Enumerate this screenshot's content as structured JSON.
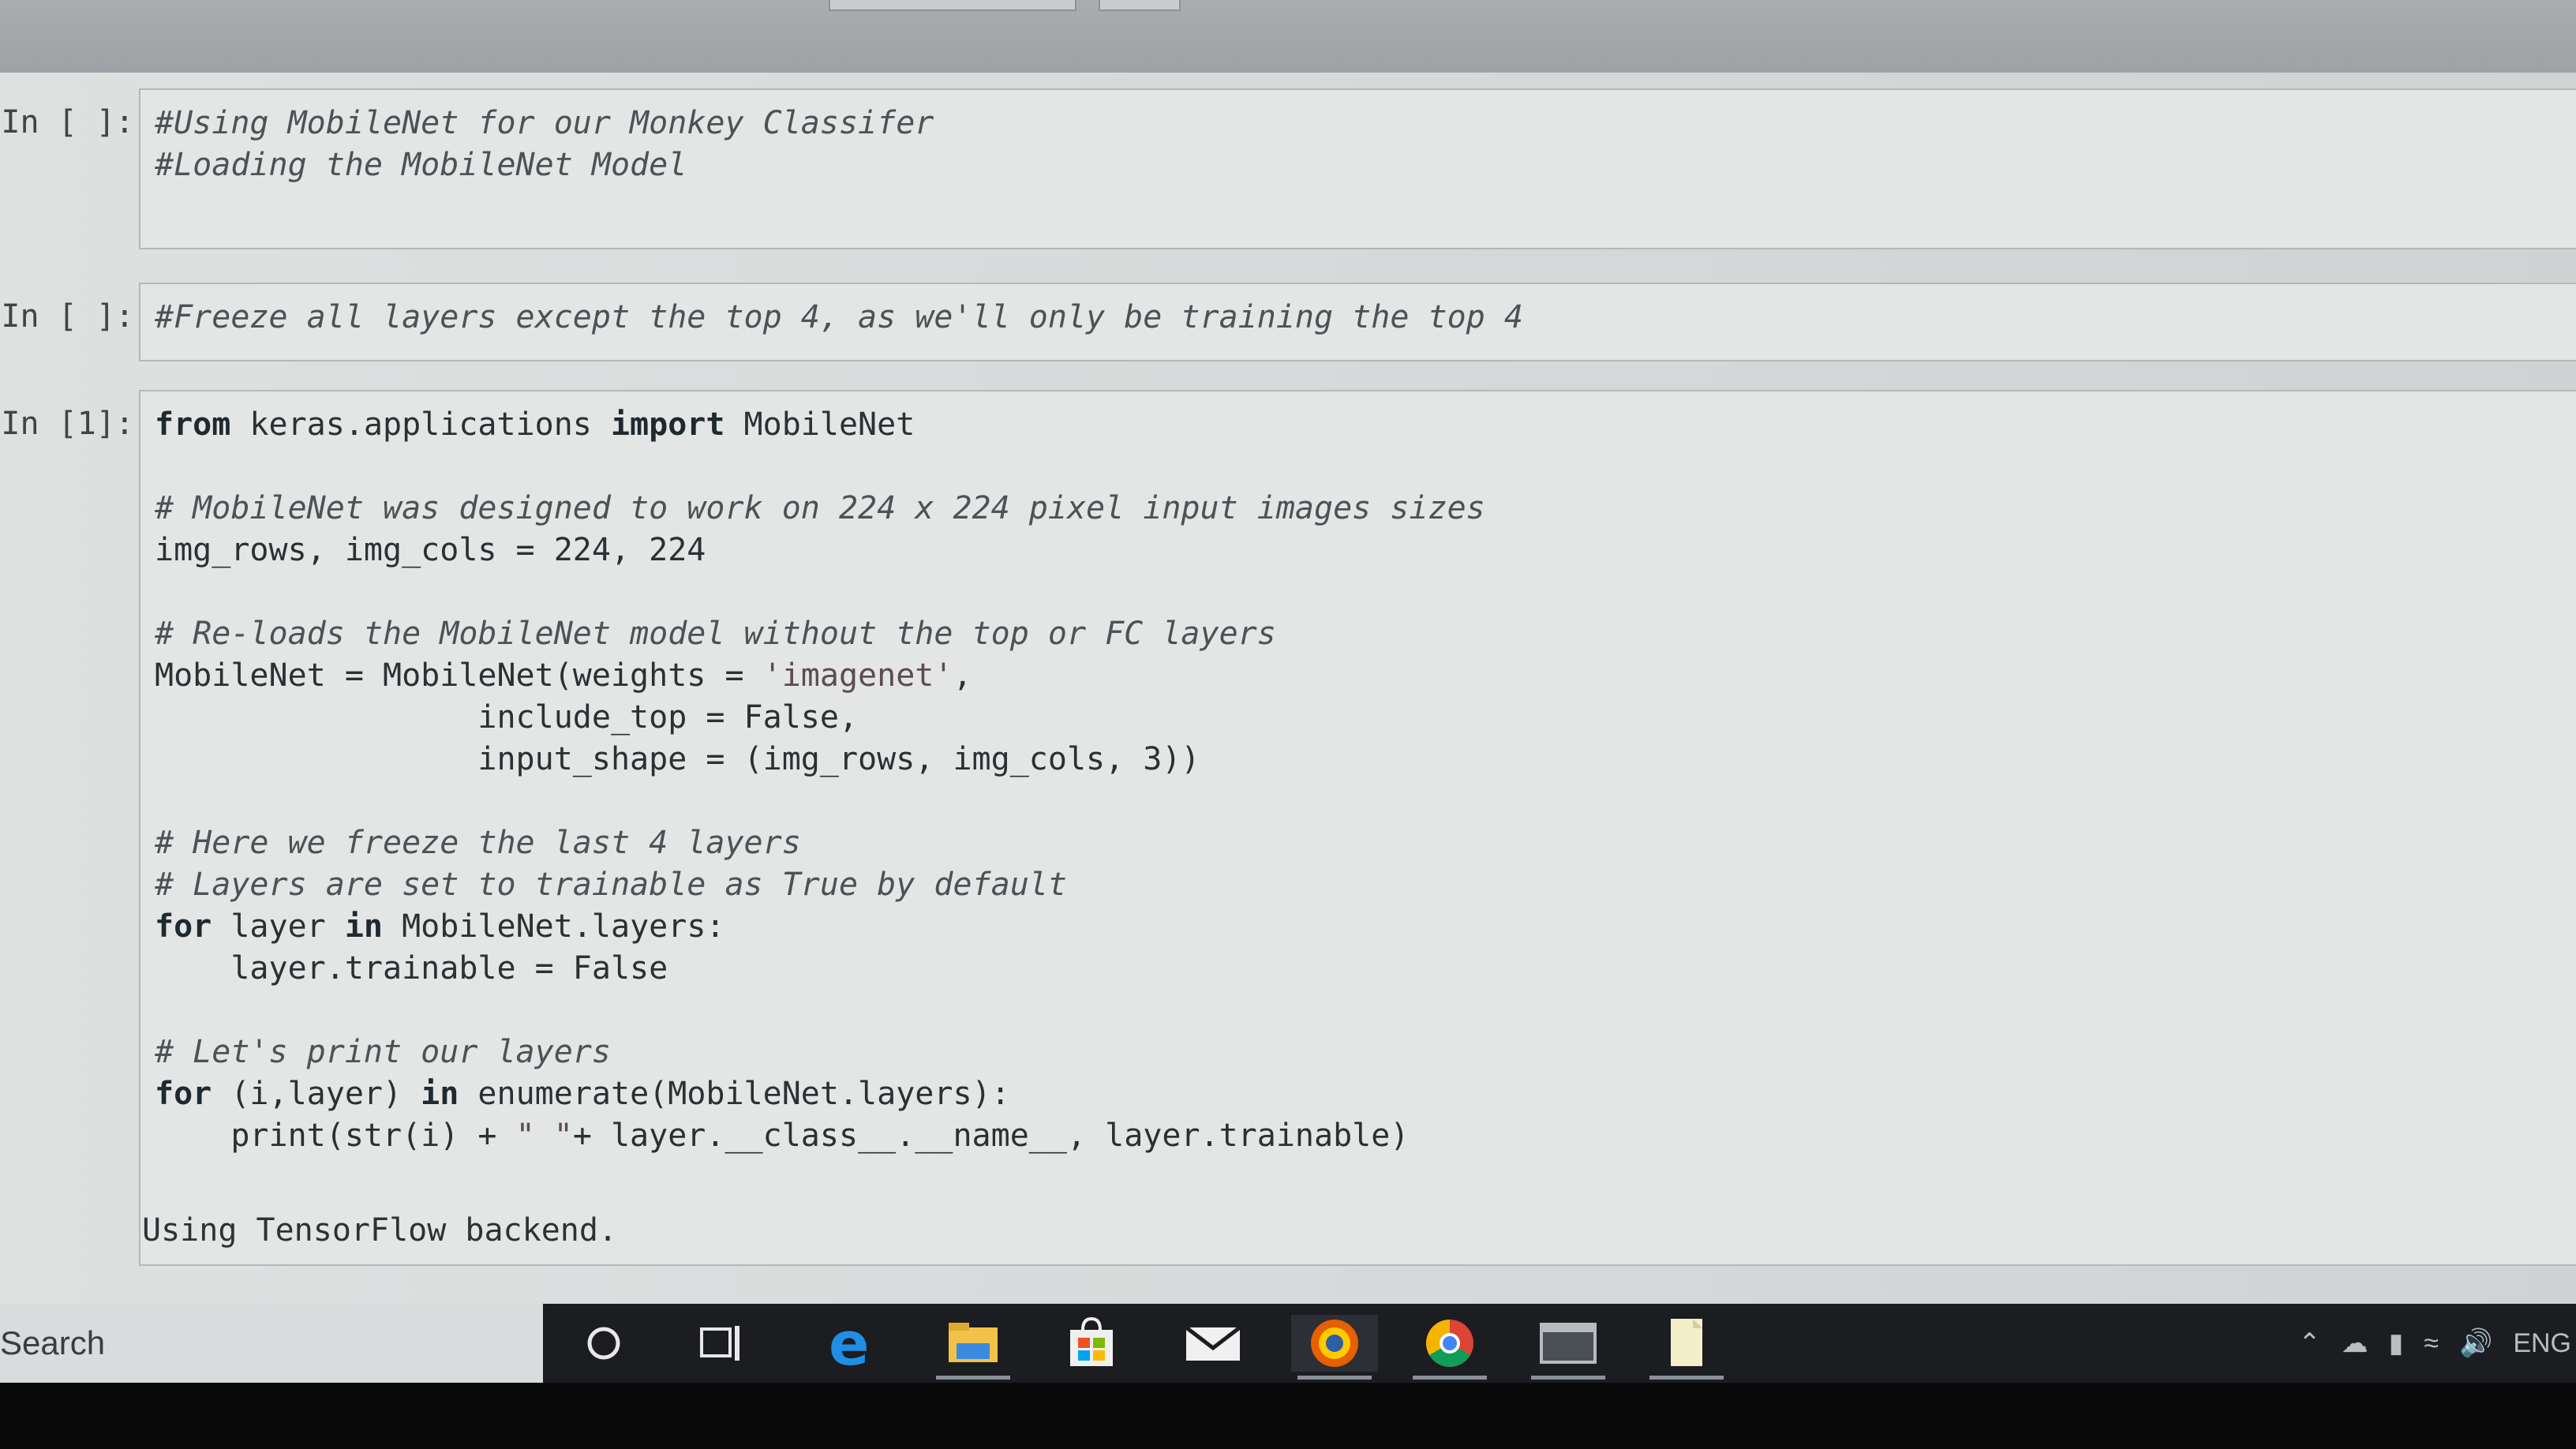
{
  "cells": [
    {
      "prompt": "In [ ]:",
      "lines": [
        [
          {
            "t": "#Using MobileNet for our Monkey Classifer",
            "c": "cm"
          }
        ],
        [
          {
            "t": "#Loading the MobileNet Model",
            "c": "cm"
          }
        ]
      ]
    },
    {
      "prompt": "In [ ]:",
      "lines": [
        [
          {
            "t": "#Freeze all layers except the top 4, as we'll only be training the top 4",
            "c": "cm"
          }
        ]
      ]
    },
    {
      "prompt": "In [1]:",
      "lines": [
        [
          {
            "t": "from",
            "c": "kw"
          },
          {
            "t": " keras.applications "
          },
          {
            "t": "import",
            "c": "kw"
          },
          {
            "t": " MobileNet"
          }
        ],
        [
          {
            "t": ""
          }
        ],
        [
          {
            "t": "# MobileNet was designed to work on 224 x 224 pixel input images sizes",
            "c": "cm"
          }
        ],
        [
          {
            "t": "img_rows, img_cols = 224, 224"
          }
        ],
        [
          {
            "t": ""
          }
        ],
        [
          {
            "t": "# Re-loads the MobileNet model without the top or FC layers",
            "c": "cm"
          }
        ],
        [
          {
            "t": "MobileNet = MobileNet(weights = "
          },
          {
            "t": "'imagenet'",
            "c": "str"
          },
          {
            "t": ","
          }
        ],
        [
          {
            "t": "                 include_top = False,"
          }
        ],
        [
          {
            "t": "                 input_shape = (img_rows, img_cols, 3))"
          }
        ],
        [
          {
            "t": ""
          }
        ],
        [
          {
            "t": "# Here we freeze the last 4 layers",
            "c": "cm"
          }
        ],
        [
          {
            "t": "# Layers are set to trainable as True by default",
            "c": "cm"
          }
        ],
        [
          {
            "t": "for",
            "c": "kw"
          },
          {
            "t": " layer "
          },
          {
            "t": "in",
            "c": "kw"
          },
          {
            "t": " MobileNet.layers:"
          }
        ],
        [
          {
            "t": "    layer.trainable = False"
          }
        ],
        [
          {
            "t": ""
          }
        ],
        [
          {
            "t": "# Let's print our layers",
            "c": "cm"
          }
        ],
        [
          {
            "t": "for",
            "c": "kw"
          },
          {
            "t": " (i,layer) "
          },
          {
            "t": "in",
            "c": "kw"
          },
          {
            "t": " enumerate(MobileNet.layers):"
          }
        ],
        [
          {
            "t": "    print(str(i) + "
          },
          {
            "t": "\" \"",
            "c": "str"
          },
          {
            "t": "+ layer.__class__.__name__, layer.trainable)"
          }
        ]
      ],
      "output": "Using TensorFlow backend."
    }
  ],
  "taskbar": {
    "search_label": "Search",
    "apps": [
      {
        "name": "cortana-icon"
      },
      {
        "name": "task-view-icon"
      },
      {
        "name": "edge-icon"
      },
      {
        "name": "file-explorer-icon"
      },
      {
        "name": "store-icon"
      },
      {
        "name": "mail-icon"
      },
      {
        "name": "firefox-icon"
      },
      {
        "name": "chrome-icon"
      },
      {
        "name": "window-app-icon"
      },
      {
        "name": "notepad-icon"
      }
    ],
    "tray_language": "ENG"
  }
}
